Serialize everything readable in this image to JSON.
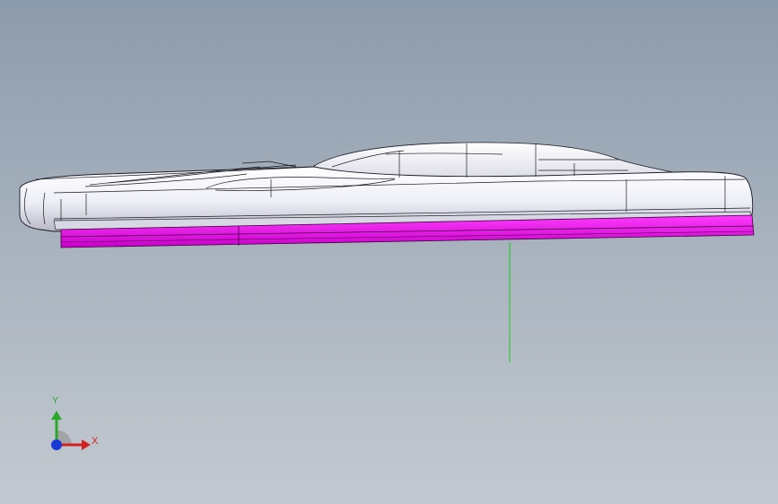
{
  "viewport": {
    "background_top": "#8c9bab",
    "background_bottom": "#c3c9d0"
  },
  "model": {
    "body_color": "#f2f1fb",
    "edge_color": "#1a1a22",
    "selected_face_color": "#e600e6"
  },
  "triad": {
    "x_label": "X",
    "y_label": "Y",
    "x_color": "#d42020",
    "y_color": "#2aa82a",
    "z_color": "#1a3ad6"
  }
}
